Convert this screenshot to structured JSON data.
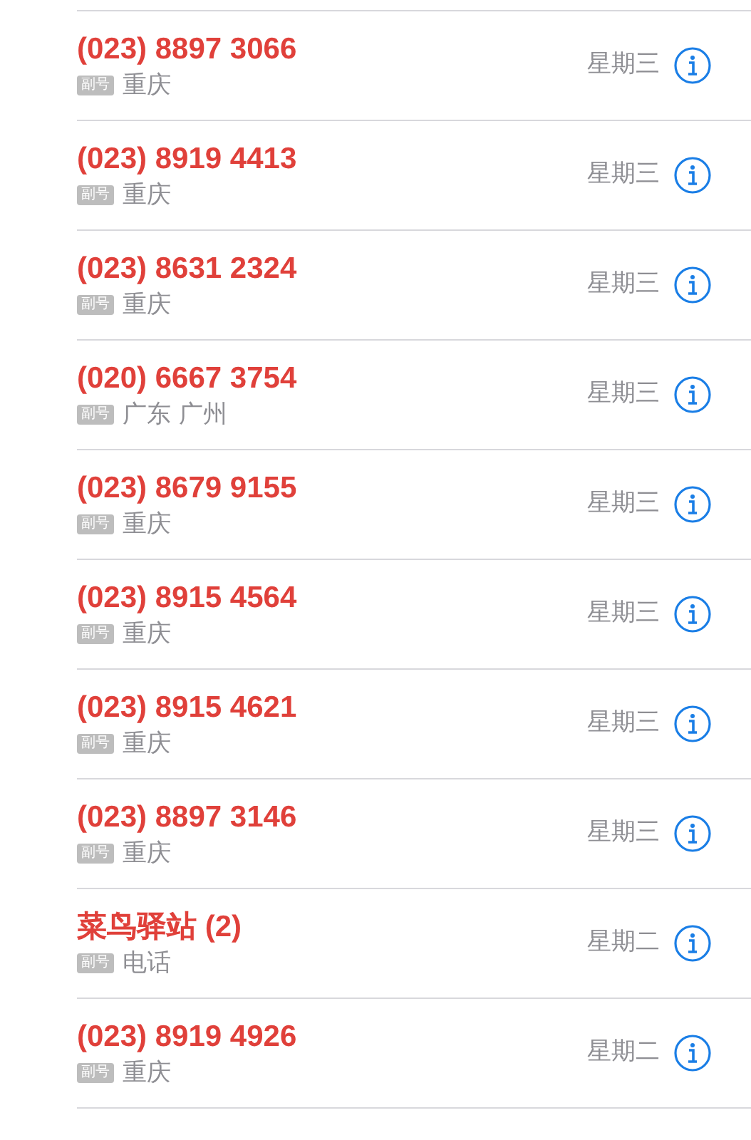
{
  "calls": [
    {
      "name": "(023) 8897 3066",
      "badge": "副号",
      "location": "重庆",
      "day": "星期三",
      "missed": true
    },
    {
      "name": "(023) 8919 4413",
      "badge": "副号",
      "location": "重庆",
      "day": "星期三",
      "missed": true
    },
    {
      "name": "(023) 8631 2324",
      "badge": "副号",
      "location": "重庆",
      "day": "星期三",
      "missed": true
    },
    {
      "name": "(020) 6667 3754",
      "badge": "副号",
      "location": "广东 广州",
      "day": "星期三",
      "missed": true
    },
    {
      "name": "(023) 8679 9155",
      "badge": "副号",
      "location": "重庆",
      "day": "星期三",
      "missed": true
    },
    {
      "name": "(023) 8915 4564",
      "badge": "副号",
      "location": "重庆",
      "day": "星期三",
      "missed": true
    },
    {
      "name": "(023) 8915 4621",
      "badge": "副号",
      "location": "重庆",
      "day": "星期三",
      "missed": true
    },
    {
      "name": "(023) 8897 3146",
      "badge": "副号",
      "location": "重庆",
      "day": "星期三",
      "missed": true
    },
    {
      "name": "菜鸟驿站 (2)",
      "badge": "副号",
      "location": "电话",
      "day": "星期二",
      "missed": true
    },
    {
      "name": "(023) 8919 4926",
      "badge": "副号",
      "location": "重庆",
      "day": "星期二",
      "missed": true
    }
  ]
}
